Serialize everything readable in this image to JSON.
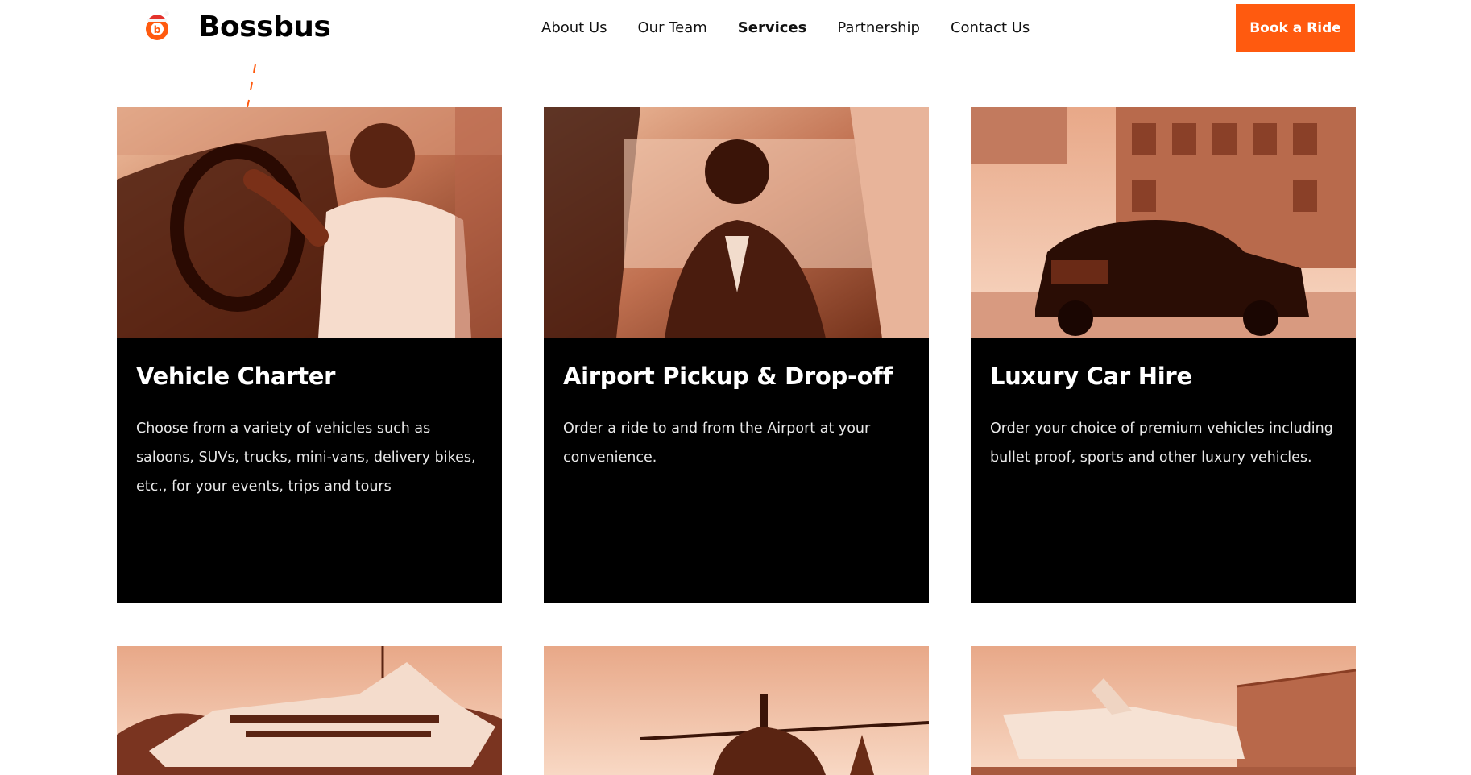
{
  "brand": {
    "name": "Bossbus",
    "accent": "#ff5a0f",
    "logo_icon": "bus-badge-santa-hat-icon"
  },
  "nav": {
    "items": [
      {
        "label": "About Us",
        "active": false
      },
      {
        "label": "Our Team",
        "active": false
      },
      {
        "label": "Services",
        "active": true
      },
      {
        "label": "Partnership",
        "active": false
      },
      {
        "label": "Contact Us",
        "active": false
      }
    ],
    "cta_label": "Book a Ride"
  },
  "services": [
    {
      "title": "Vehicle Charter",
      "description": "Choose from a variety of vehicles such as saloons, SUVs, trucks, mini-vans, delivery bikes, etc., for your events, trips and tours",
      "image": "driver-at-wheel-photo"
    },
    {
      "title": "Airport Pickup & Drop-off",
      "description": "Order a ride to and from the Airport at your convenience.",
      "image": "passenger-in-back-seat-photo"
    },
    {
      "title": "Luxury Car Hire",
      "description": "Order your choice of premium vehicles including bullet proof, sports and other luxury vehicles.",
      "image": "luxury-sedan-photo"
    },
    {
      "title": "",
      "description": "",
      "image": "yacht-photo"
    },
    {
      "title": "",
      "description": "",
      "image": "helicopter-photo"
    },
    {
      "title": "",
      "description": "",
      "image": "private-jet-photo"
    }
  ]
}
